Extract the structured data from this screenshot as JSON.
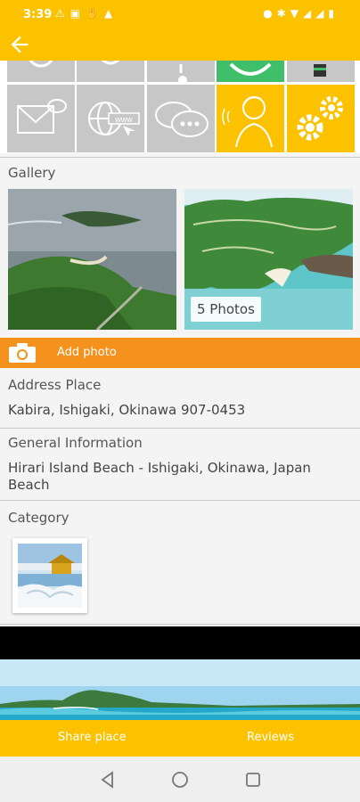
{
  "status_bar": {
    "time": "3:39",
    "left_icons": [
      "notification-bell-icon",
      "image-icon",
      "hand-icon",
      "cast-icon"
    ],
    "right_icons": [
      "location-icon",
      "bluetooth-icon",
      "wifi-icon",
      "signal-icon",
      "signal-icon",
      "battery-icon"
    ]
  },
  "app_bar": {
    "back_icon": "arrow-left-icon"
  },
  "tiles": {
    "top_row": [
      "sun-icon",
      "heart-icon",
      "pin-icon",
      "clock-icon",
      "book-icon"
    ],
    "bottom_row": [
      "mail-icon",
      "www-icon",
      "chat-icon",
      "audio-guide-icon",
      "settings-icon"
    ]
  },
  "gallery": {
    "label": "Gallery",
    "photo_count": "5 Photos"
  },
  "add_photo": {
    "label": "Add photo",
    "icon": "camera-icon"
  },
  "address": {
    "label": "Address Place",
    "value": "Kabira, Ishigaki, Okinawa 907-0453"
  },
  "general": {
    "label": "General Information",
    "value": "Hirari Island Beach - Ishigaki, Okinawa, Japan Beach"
  },
  "category": {
    "label": "Category"
  },
  "bottom_bar": {
    "share_label": "Share place",
    "reviews_label": "Reviews"
  },
  "colors": {
    "primary": "#fcc200",
    "accent": "#f5921e",
    "tile_gray": "#c7c7c7",
    "tile_green": "#3fbf6a"
  }
}
